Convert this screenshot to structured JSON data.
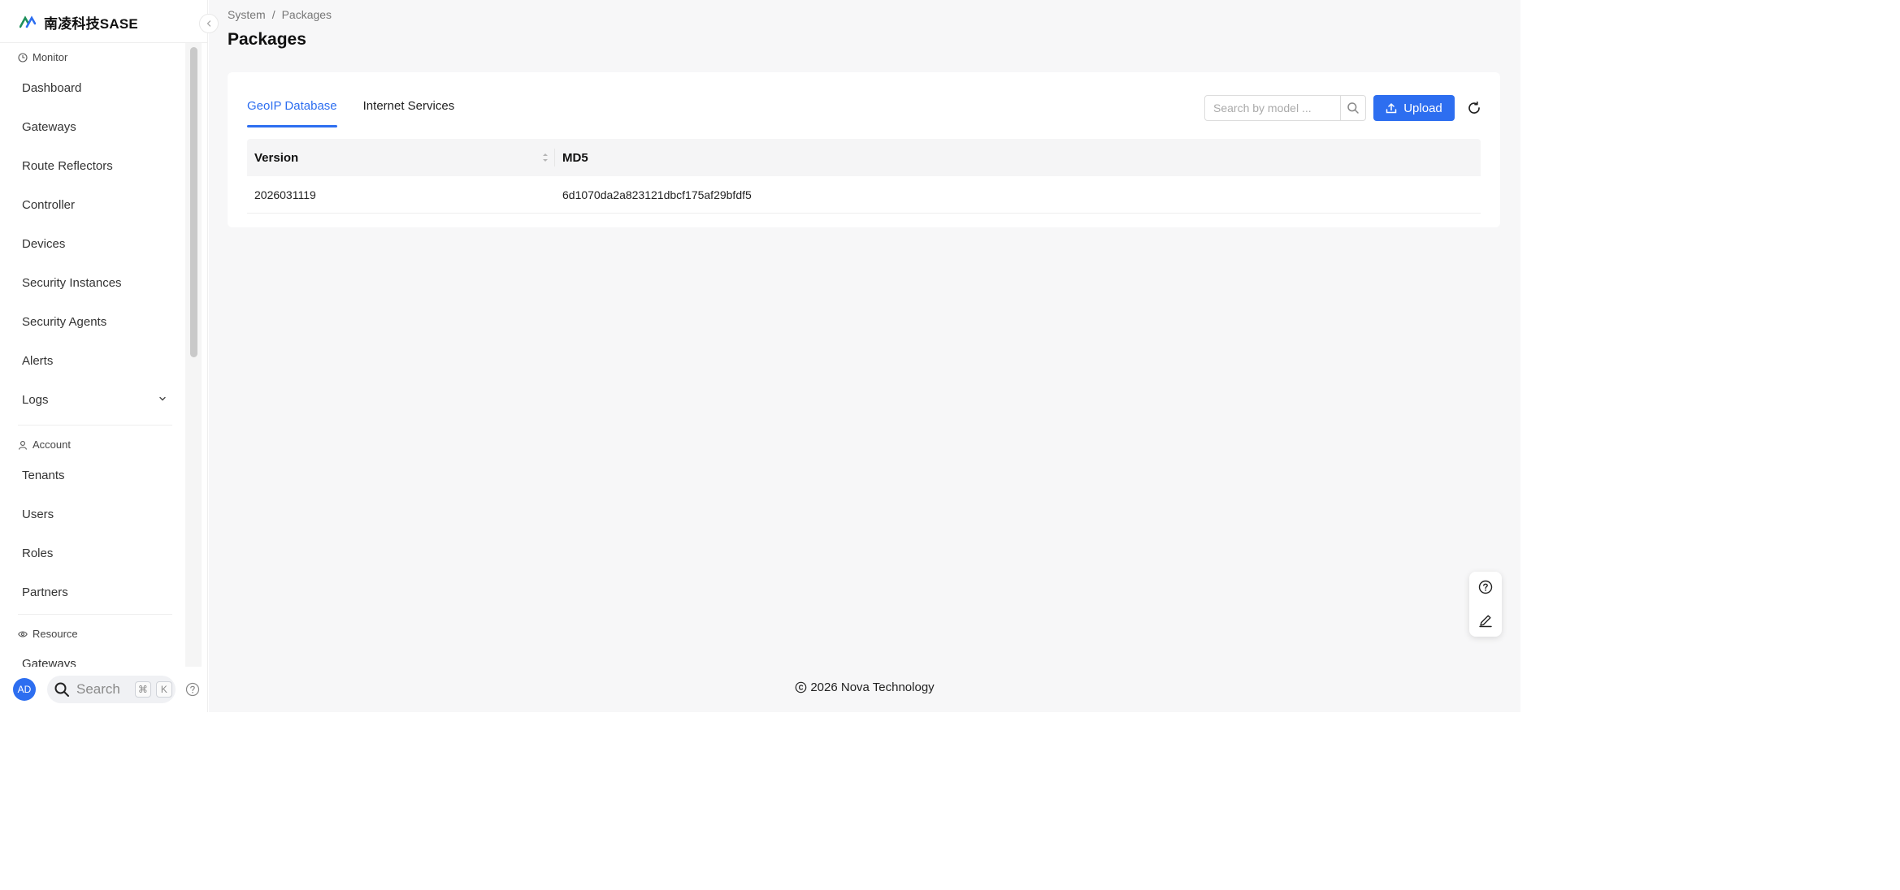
{
  "brand": {
    "name": "南凌科技SASE"
  },
  "sidebar": {
    "groups": [
      {
        "title": "Monitor",
        "icon": "clock-icon",
        "items": [
          "Dashboard",
          "Gateways",
          "Route Reflectors",
          "Controller",
          "Devices",
          "Security Instances",
          "Security Agents",
          "Alerts",
          "Logs"
        ]
      },
      {
        "title": "Account",
        "icon": "user-icon",
        "items": [
          "Tenants",
          "Users",
          "Roles",
          "Partners"
        ]
      },
      {
        "title": "Resource",
        "icon": "eye-icon",
        "items": [
          "Gateways"
        ]
      }
    ],
    "user_initials": "AD",
    "search_label": "Search",
    "shortcut_keys": [
      "⌘",
      "K"
    ]
  },
  "breadcrumb": {
    "root": "System",
    "sep": "/",
    "current": "Packages"
  },
  "page_title": "Packages",
  "tabs": [
    {
      "label": "GeoIP Database",
      "active": true
    },
    {
      "label": "Internet Services",
      "active": false
    }
  ],
  "toolbar": {
    "search_placeholder": "Search by model ...",
    "upload_label": "Upload"
  },
  "table": {
    "columns": [
      "Version",
      "MD5"
    ],
    "rows": [
      [
        "2026031119",
        "6d1070da2a823121dbcf175af29bfdf5"
      ]
    ]
  },
  "footer": {
    "text": "2026 Nova Technology"
  },
  "colors": {
    "primary": "#2d6ef0"
  }
}
